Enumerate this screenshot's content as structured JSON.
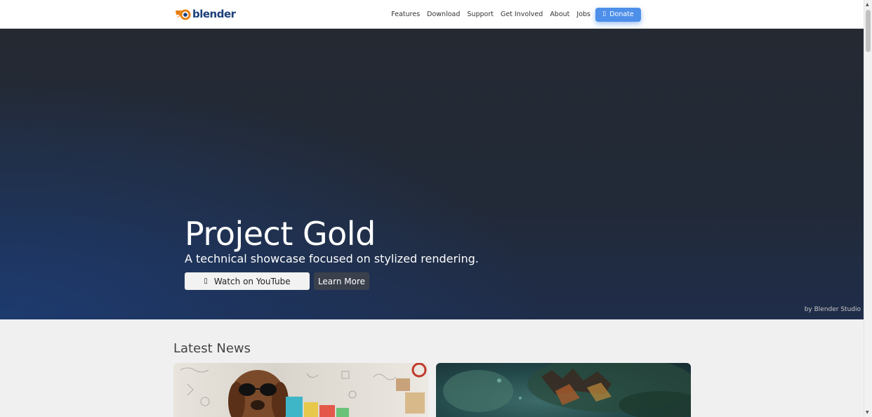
{
  "navbar": {
    "logo_text": "blender",
    "links": [
      {
        "label": "Features"
      },
      {
        "label": "Download"
      },
      {
        "label": "Support"
      },
      {
        "label": "Get Involved"
      },
      {
        "label": "About"
      },
      {
        "label": "Jobs"
      }
    ],
    "donate": {
      "label": "Donate",
      "icon": "heart-icon"
    }
  },
  "hero": {
    "title": "Project Gold",
    "subtitle": "A technical showcase focused on stylized rendering.",
    "primary_button": {
      "label": "Watch on YouTube",
      "icon": "play-icon"
    },
    "secondary_button": {
      "label": "Learn More"
    },
    "credit": "by Blender Studio"
  },
  "news": {
    "title": "Latest News"
  },
  "colors": {
    "accent": "#4e8fea",
    "logo_orange": "#e87d0d",
    "logo_blue": "#1b3f7a"
  }
}
